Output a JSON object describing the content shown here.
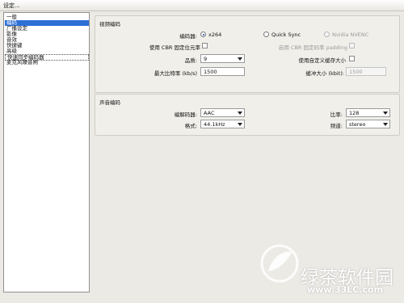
{
  "window": {
    "title": "设定..."
  },
  "sidebar": {
    "items": [
      {
        "label": "一般"
      },
      {
        "label": "编码"
      },
      {
        "label": "广播设定"
      },
      {
        "label": "影像"
      },
      {
        "label": "音效"
      },
      {
        "label": "快捷键"
      },
      {
        "label": "高级"
      },
      {
        "label": "快速同步编码器"
      },
      {
        "label": "麦克风噪音闸"
      }
    ],
    "selected": "编码"
  },
  "video": {
    "title": "视频编码",
    "encoder_label": "编码器:",
    "encoder_options": [
      "x264",
      "Quick Sync",
      "Nvidia NVENC"
    ],
    "use_cbr_label": "使用 CBR 固定位元率",
    "enable_cbr_padding_label": "启用 CBR 固定码率 padding",
    "quality_label": "品质:",
    "quality_value": "9",
    "custom_buffer_label": "使用自定义缓存大小",
    "max_bitrate_label": "最大比特率 (kb/s)",
    "max_bitrate_value": "1500",
    "buffer_size_label": "缓冲大小 (kbit):",
    "buffer_size_value": "1500"
  },
  "audio": {
    "title": "声音编码",
    "codec_label": "编解码器:",
    "codec_value": "AAC",
    "bitrate_label": "比率:",
    "bitrate_value": "128",
    "format_label": "格式:",
    "format_value": "44.1kHz",
    "channels_label": "频道:",
    "channels_value": "stereo"
  },
  "watermark": {
    "brand": "绿茶软件园",
    "url": "www.33LC.com"
  },
  "icons": {
    "radio": "radio-icon",
    "checkbox": "checkbox-icon",
    "dropdown": "chevron-down-icon"
  }
}
